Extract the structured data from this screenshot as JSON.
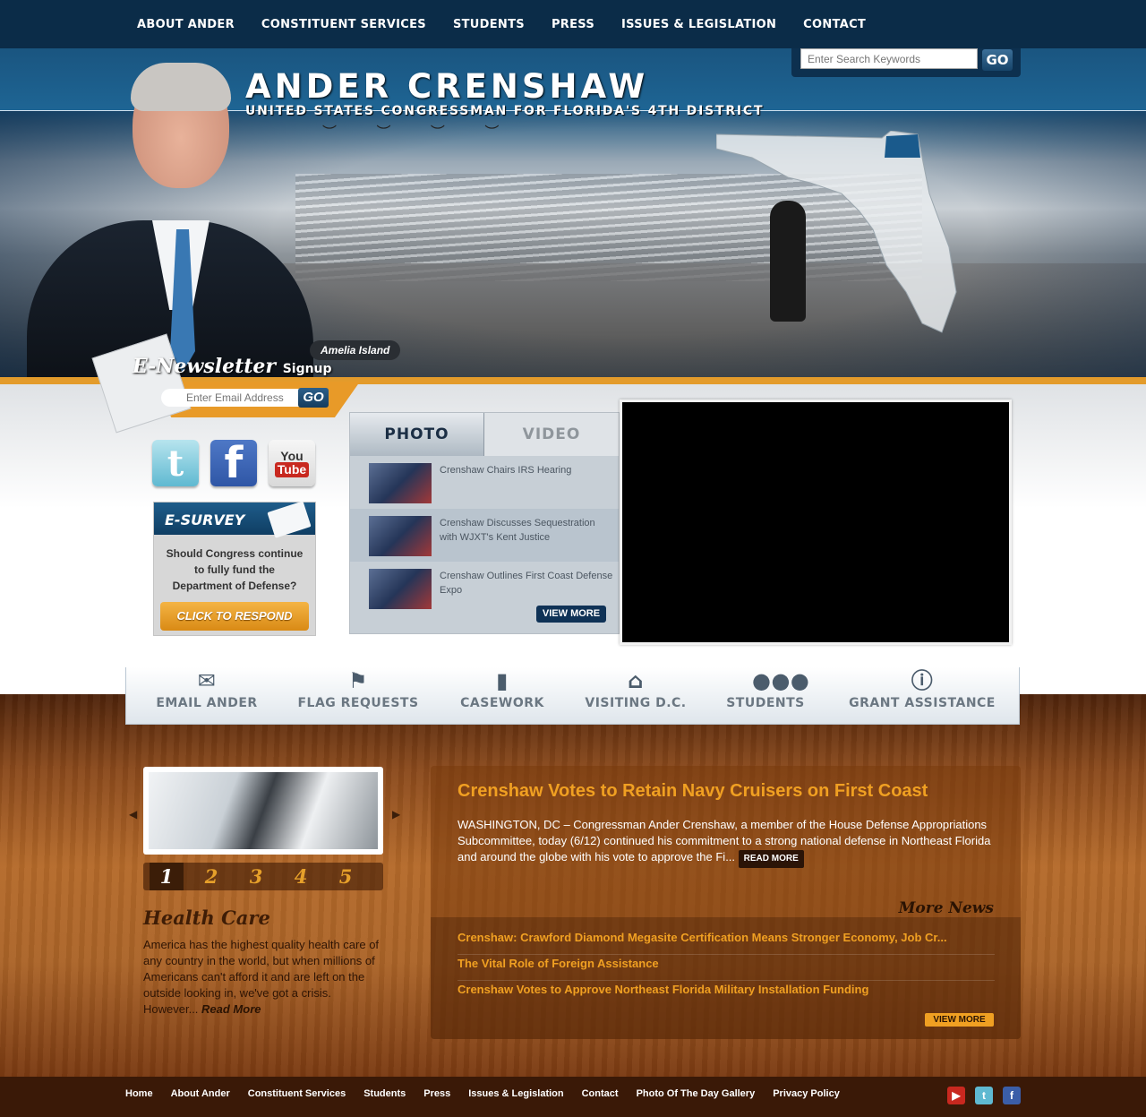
{
  "topnav": {
    "items": [
      "ABOUT ANDER",
      "CONSTITUENT SERVICES",
      "STUDENTS",
      "PRESS",
      "ISSUES & LEGISLATION",
      "CONTACT"
    ]
  },
  "header": {
    "name": "ANDER CRENSHAW",
    "subtitle": "UNITED STATES CONGRESSMAN FOR FLORIDA'S 4TH DISTRICT",
    "location": "Amelia Island"
  },
  "search": {
    "placeholder": "Enter Search Keywords",
    "button": "GO"
  },
  "newsletter": {
    "title": "E-Newsletter",
    "title_suffix": "Signup",
    "placeholder": "Enter Email Address",
    "button": "GO"
  },
  "social": {
    "twitter": "t",
    "facebook": "f",
    "youtube_you": "You",
    "youtube_tube": "Tube"
  },
  "esurvey": {
    "title": "E-SURVEY",
    "question": "Should Congress continue to fully fund the Department of Defense?",
    "button": "CLICK TO RESPOND"
  },
  "media": {
    "tabs": [
      "PHOTO",
      "VIDEO"
    ],
    "items": [
      "Crenshaw Chairs IRS Hearing",
      "Crenshaw Discusses Sequestration with WJXT's Kent Justice",
      "Crenshaw Outlines First Coast Defense Expo"
    ],
    "view_more": "VIEW MORE"
  },
  "quicklinks": [
    {
      "label": "EMAIL ANDER",
      "icon": "envelope-icon"
    },
    {
      "label": "FLAG REQUESTS",
      "icon": "flag-icon"
    },
    {
      "label": "CASEWORK",
      "icon": "binder-icon"
    },
    {
      "label": "VISITING D.C.",
      "icon": "capitol-icon"
    },
    {
      "label": "STUDENTS",
      "icon": "people-icon"
    },
    {
      "label": "GRANT ASSISTANCE",
      "icon": "info-icon"
    }
  ],
  "feature": {
    "pages": [
      "1",
      "2",
      "3",
      "4",
      "5"
    ],
    "active_page": "1",
    "title": "Health Care",
    "text": "America has the highest quality health care of any country in the world, but when millions of Americans can't afford it and are left on the outside looking in, we've got a crisis. However... ",
    "read_more": "Read More"
  },
  "news": {
    "headline": "Crenshaw Votes to Retain Navy Cruisers on First Coast",
    "body": "WASHINGTON, DC – Congressman Ander Crenshaw, a member of the House Defense Appropriations Subcommittee, today (6/12) continued his commitment to a strong national defense in Northeast Florida and around the globe with his vote to approve the Fi... ",
    "read_more": "READ MORE",
    "more_news": "More News",
    "links": [
      "Crenshaw: Crawford Diamond Megasite Certification Means Stronger Economy, Job Cr...",
      "The Vital Role of Foreign Assistance",
      "Crenshaw Votes to Approve Northeast Florida Military Installation Funding"
    ],
    "view_more": "VIEW MORE"
  },
  "footer": {
    "links": [
      "Home",
      "About Ander",
      "Constituent Services",
      "Students",
      "Press",
      "Issues & Legislation",
      "Contact",
      "Photo Of The Day Gallery",
      "Privacy Policy"
    ],
    "icons": [
      "youtube-icon",
      "twitter-icon",
      "facebook-icon"
    ]
  }
}
